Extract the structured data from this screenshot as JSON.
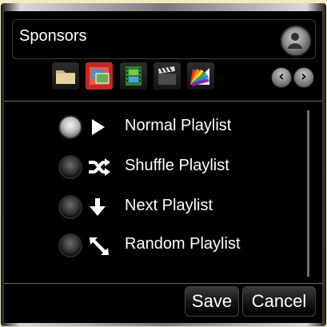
{
  "dialog": {
    "title": "Sponsors"
  },
  "toolbar": {
    "buttons": [
      "folder-icon",
      "media-icon",
      "film-icon",
      "clapperboard-icon",
      "color-palette-icon"
    ],
    "nav_prev": "‹",
    "nav_next": "›"
  },
  "options": [
    {
      "label": "Normal Playlist",
      "icon": "play-icon",
      "selected": true
    },
    {
      "label": "Shuffle Playlist",
      "icon": "shuffle-icon",
      "selected": false
    },
    {
      "label": "Next Playlist",
      "icon": "arrow-down-icon",
      "selected": false
    },
    {
      "label": "Random Playlist",
      "icon": "random-arrows-icon",
      "selected": false
    }
  ],
  "footer": {
    "save_label": "Save",
    "cancel_label": "Cancel"
  }
}
